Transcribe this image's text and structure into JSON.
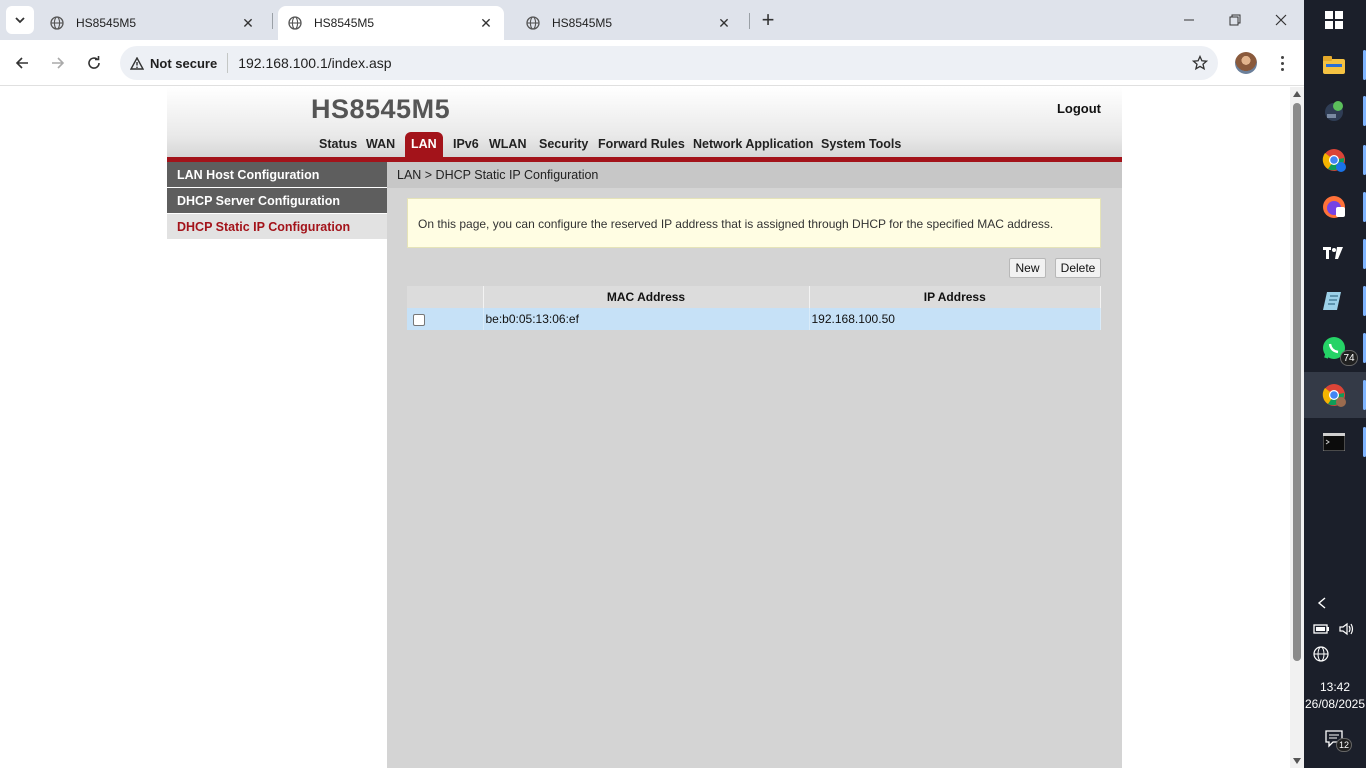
{
  "browser": {
    "tabs": [
      {
        "title": "HS8545M5",
        "active": false
      },
      {
        "title": "HS8545M5",
        "active": true
      },
      {
        "title": "HS8545M5",
        "active": false
      }
    ],
    "security_label": "Not secure",
    "url": "192.168.100.1/index.asp"
  },
  "router": {
    "model": "HS8545M5",
    "logout_label": "Logout",
    "nav": [
      {
        "label": "Status",
        "active": false
      },
      {
        "label": "WAN",
        "active": false
      },
      {
        "label": "LAN",
        "active": true
      },
      {
        "label": "IPv6",
        "active": false
      },
      {
        "label": "WLAN",
        "active": false
      },
      {
        "label": "Security",
        "active": false
      },
      {
        "label": "Forward Rules",
        "active": false
      },
      {
        "label": "Network Application",
        "active": false
      },
      {
        "label": "System Tools",
        "active": false
      }
    ],
    "sidebar": [
      {
        "label": "LAN Host Configuration",
        "selected": false
      },
      {
        "label": "DHCP Server Configuration",
        "selected": false
      },
      {
        "label": "DHCP Static IP Configuration",
        "selected": true
      }
    ],
    "breadcrumb": "LAN > DHCP Static IP Configuration",
    "notice": "On this page, you can configure the reserved IP address that is assigned through DHCP for the specified MAC address.",
    "buttons": {
      "new": "New",
      "delete": "Delete"
    },
    "table": {
      "headers": [
        "",
        "MAC Address",
        "IP Address"
      ],
      "rows": [
        {
          "checked": false,
          "mac": "be:b0:05:13:06:ef",
          "ip": "192.168.100.50"
        }
      ]
    }
  },
  "taskbar": {
    "whatsapp_badge": "74",
    "clock_time": "13:42",
    "clock_date": "26/08/2025",
    "notifications_badge": "12"
  },
  "colors": {
    "brand_red": "#a3131a",
    "row_highlight": "#c6e1f7",
    "notice_bg": "#fffde3"
  }
}
